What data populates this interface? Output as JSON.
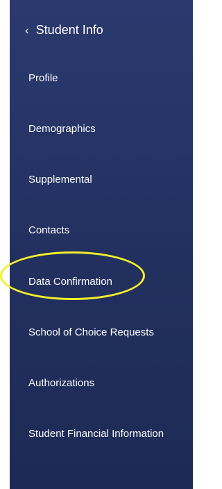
{
  "header": {
    "back_glyph": "‹",
    "title": "Student Info"
  },
  "nav": {
    "items": [
      {
        "label": "Profile"
      },
      {
        "label": "Demographics"
      },
      {
        "label": "Supplemental"
      },
      {
        "label": "Contacts"
      },
      {
        "label": "Data Confirmation"
      },
      {
        "label": "School of Choice Requests"
      },
      {
        "label": "Authorizations"
      },
      {
        "label": "Student Financial Information"
      }
    ]
  },
  "annotation": {
    "ring_color": "#f3ef2a",
    "highlighted_item": "Data Confirmation"
  },
  "colors": {
    "sidebar_bg": "#22305f",
    "text": "#ffffff"
  }
}
